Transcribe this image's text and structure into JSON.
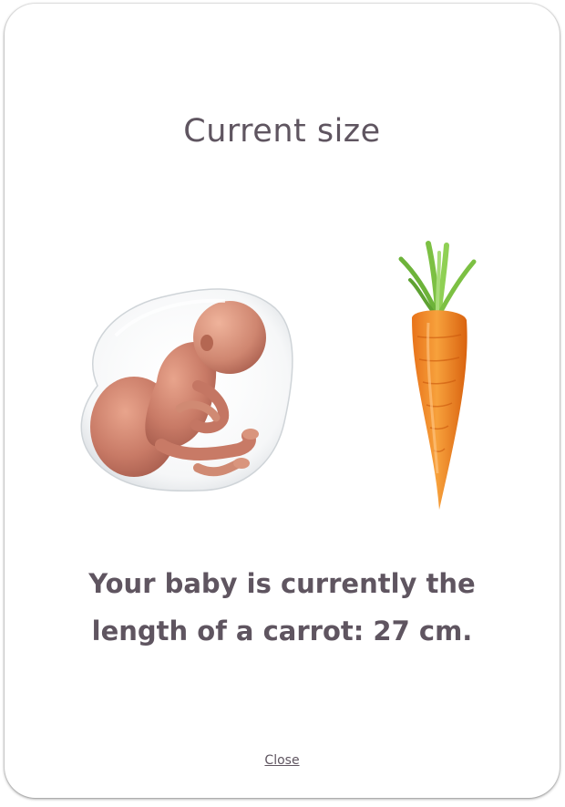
{
  "modal": {
    "title": "Current size",
    "message": "Your baby is currently the length of a carrot: 27 cm.",
    "close_label": "Close"
  },
  "illustrations": {
    "fetus": "fetus-illustration",
    "comparison": "carrot-illustration"
  },
  "colors": {
    "text": "#5f5560",
    "background": "#ffffff"
  }
}
